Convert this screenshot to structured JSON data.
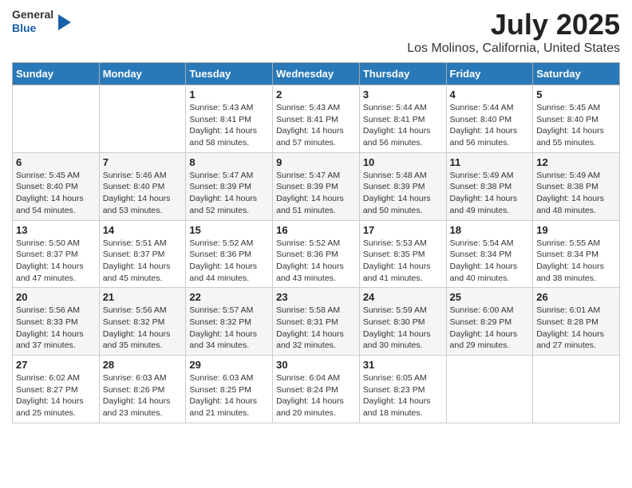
{
  "header": {
    "logo": {
      "line1": "General",
      "line2": "Blue"
    },
    "title": "July 2025",
    "subtitle": "Los Molinos, California, United States"
  },
  "calendar": {
    "days_of_week": [
      "Sunday",
      "Monday",
      "Tuesday",
      "Wednesday",
      "Thursday",
      "Friday",
      "Saturday"
    ],
    "weeks": [
      [
        {
          "day": "",
          "info": ""
        },
        {
          "day": "",
          "info": ""
        },
        {
          "day": "1",
          "info": "Sunrise: 5:43 AM\nSunset: 8:41 PM\nDaylight: 14 hours and 58 minutes."
        },
        {
          "day": "2",
          "info": "Sunrise: 5:43 AM\nSunset: 8:41 PM\nDaylight: 14 hours and 57 minutes."
        },
        {
          "day": "3",
          "info": "Sunrise: 5:44 AM\nSunset: 8:41 PM\nDaylight: 14 hours and 56 minutes."
        },
        {
          "day": "4",
          "info": "Sunrise: 5:44 AM\nSunset: 8:40 PM\nDaylight: 14 hours and 56 minutes."
        },
        {
          "day": "5",
          "info": "Sunrise: 5:45 AM\nSunset: 8:40 PM\nDaylight: 14 hours and 55 minutes."
        }
      ],
      [
        {
          "day": "6",
          "info": "Sunrise: 5:45 AM\nSunset: 8:40 PM\nDaylight: 14 hours and 54 minutes."
        },
        {
          "day": "7",
          "info": "Sunrise: 5:46 AM\nSunset: 8:40 PM\nDaylight: 14 hours and 53 minutes."
        },
        {
          "day": "8",
          "info": "Sunrise: 5:47 AM\nSunset: 8:39 PM\nDaylight: 14 hours and 52 minutes."
        },
        {
          "day": "9",
          "info": "Sunrise: 5:47 AM\nSunset: 8:39 PM\nDaylight: 14 hours and 51 minutes."
        },
        {
          "day": "10",
          "info": "Sunrise: 5:48 AM\nSunset: 8:39 PM\nDaylight: 14 hours and 50 minutes."
        },
        {
          "day": "11",
          "info": "Sunrise: 5:49 AM\nSunset: 8:38 PM\nDaylight: 14 hours and 49 minutes."
        },
        {
          "day": "12",
          "info": "Sunrise: 5:49 AM\nSunset: 8:38 PM\nDaylight: 14 hours and 48 minutes."
        }
      ],
      [
        {
          "day": "13",
          "info": "Sunrise: 5:50 AM\nSunset: 8:37 PM\nDaylight: 14 hours and 47 minutes."
        },
        {
          "day": "14",
          "info": "Sunrise: 5:51 AM\nSunset: 8:37 PM\nDaylight: 14 hours and 45 minutes."
        },
        {
          "day": "15",
          "info": "Sunrise: 5:52 AM\nSunset: 8:36 PM\nDaylight: 14 hours and 44 minutes."
        },
        {
          "day": "16",
          "info": "Sunrise: 5:52 AM\nSunset: 8:36 PM\nDaylight: 14 hours and 43 minutes."
        },
        {
          "day": "17",
          "info": "Sunrise: 5:53 AM\nSunset: 8:35 PM\nDaylight: 14 hours and 41 minutes."
        },
        {
          "day": "18",
          "info": "Sunrise: 5:54 AM\nSunset: 8:34 PM\nDaylight: 14 hours and 40 minutes."
        },
        {
          "day": "19",
          "info": "Sunrise: 5:55 AM\nSunset: 8:34 PM\nDaylight: 14 hours and 38 minutes."
        }
      ],
      [
        {
          "day": "20",
          "info": "Sunrise: 5:56 AM\nSunset: 8:33 PM\nDaylight: 14 hours and 37 minutes."
        },
        {
          "day": "21",
          "info": "Sunrise: 5:56 AM\nSunset: 8:32 PM\nDaylight: 14 hours and 35 minutes."
        },
        {
          "day": "22",
          "info": "Sunrise: 5:57 AM\nSunset: 8:32 PM\nDaylight: 14 hours and 34 minutes."
        },
        {
          "day": "23",
          "info": "Sunrise: 5:58 AM\nSunset: 8:31 PM\nDaylight: 14 hours and 32 minutes."
        },
        {
          "day": "24",
          "info": "Sunrise: 5:59 AM\nSunset: 8:30 PM\nDaylight: 14 hours and 30 minutes."
        },
        {
          "day": "25",
          "info": "Sunrise: 6:00 AM\nSunset: 8:29 PM\nDaylight: 14 hours and 29 minutes."
        },
        {
          "day": "26",
          "info": "Sunrise: 6:01 AM\nSunset: 8:28 PM\nDaylight: 14 hours and 27 minutes."
        }
      ],
      [
        {
          "day": "27",
          "info": "Sunrise: 6:02 AM\nSunset: 8:27 PM\nDaylight: 14 hours and 25 minutes."
        },
        {
          "day": "28",
          "info": "Sunrise: 6:03 AM\nSunset: 8:26 PM\nDaylight: 14 hours and 23 minutes."
        },
        {
          "day": "29",
          "info": "Sunrise: 6:03 AM\nSunset: 8:25 PM\nDaylight: 14 hours and 21 minutes."
        },
        {
          "day": "30",
          "info": "Sunrise: 6:04 AM\nSunset: 8:24 PM\nDaylight: 14 hours and 20 minutes."
        },
        {
          "day": "31",
          "info": "Sunrise: 6:05 AM\nSunset: 8:23 PM\nDaylight: 14 hours and 18 minutes."
        },
        {
          "day": "",
          "info": ""
        },
        {
          "day": "",
          "info": ""
        }
      ]
    ]
  }
}
